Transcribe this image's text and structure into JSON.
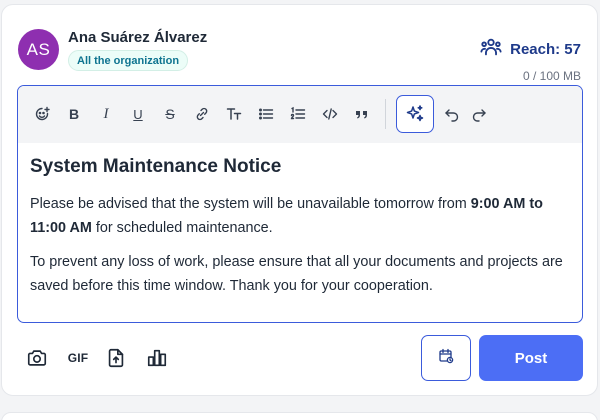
{
  "author": {
    "initials": "AS",
    "name": "Ana Suárez Álvarez",
    "audience": "All the organization",
    "avatar_color": "#8e2fb0"
  },
  "reach": {
    "label": "Reach: 57",
    "icon": "group-icon"
  },
  "storage": {
    "text": "0 / 100 MB"
  },
  "toolbar": {
    "items": [
      {
        "name": "emoji-icon"
      },
      {
        "name": "bold-icon",
        "glyph": "B"
      },
      {
        "name": "italic-icon",
        "glyph": "I"
      },
      {
        "name": "underline-icon",
        "glyph": "U"
      },
      {
        "name": "strikethrough-icon",
        "glyph": "S"
      },
      {
        "name": "link-icon"
      },
      {
        "name": "text-size-icon"
      },
      {
        "name": "bullet-list-icon"
      },
      {
        "name": "numbered-list-icon"
      },
      {
        "name": "code-icon"
      },
      {
        "name": "quote-icon"
      },
      {
        "name": "ai-sparkle-icon"
      },
      {
        "name": "undo-icon"
      },
      {
        "name": "redo-icon"
      }
    ]
  },
  "document": {
    "title": "System Maintenance Notice",
    "para1_before": "Please be advised that the system will be unavailable tomorrow from ",
    "para1_bold": "9:00 AM to 11:00 AM",
    "para1_after": " for scheduled maintenance.",
    "para2": "To prevent any loss of work, please ensure that all your documents and projects are saved before this time window. Thank you for your cooperation."
  },
  "attachments": {
    "gif_label": "GIF"
  },
  "actions": {
    "post_label": "Post"
  },
  "colors": {
    "accent": "#4c6ef5",
    "accent_border": "#3b5bdb",
    "reach_text": "#1e3a8a",
    "chip_text": "#0e7490"
  }
}
